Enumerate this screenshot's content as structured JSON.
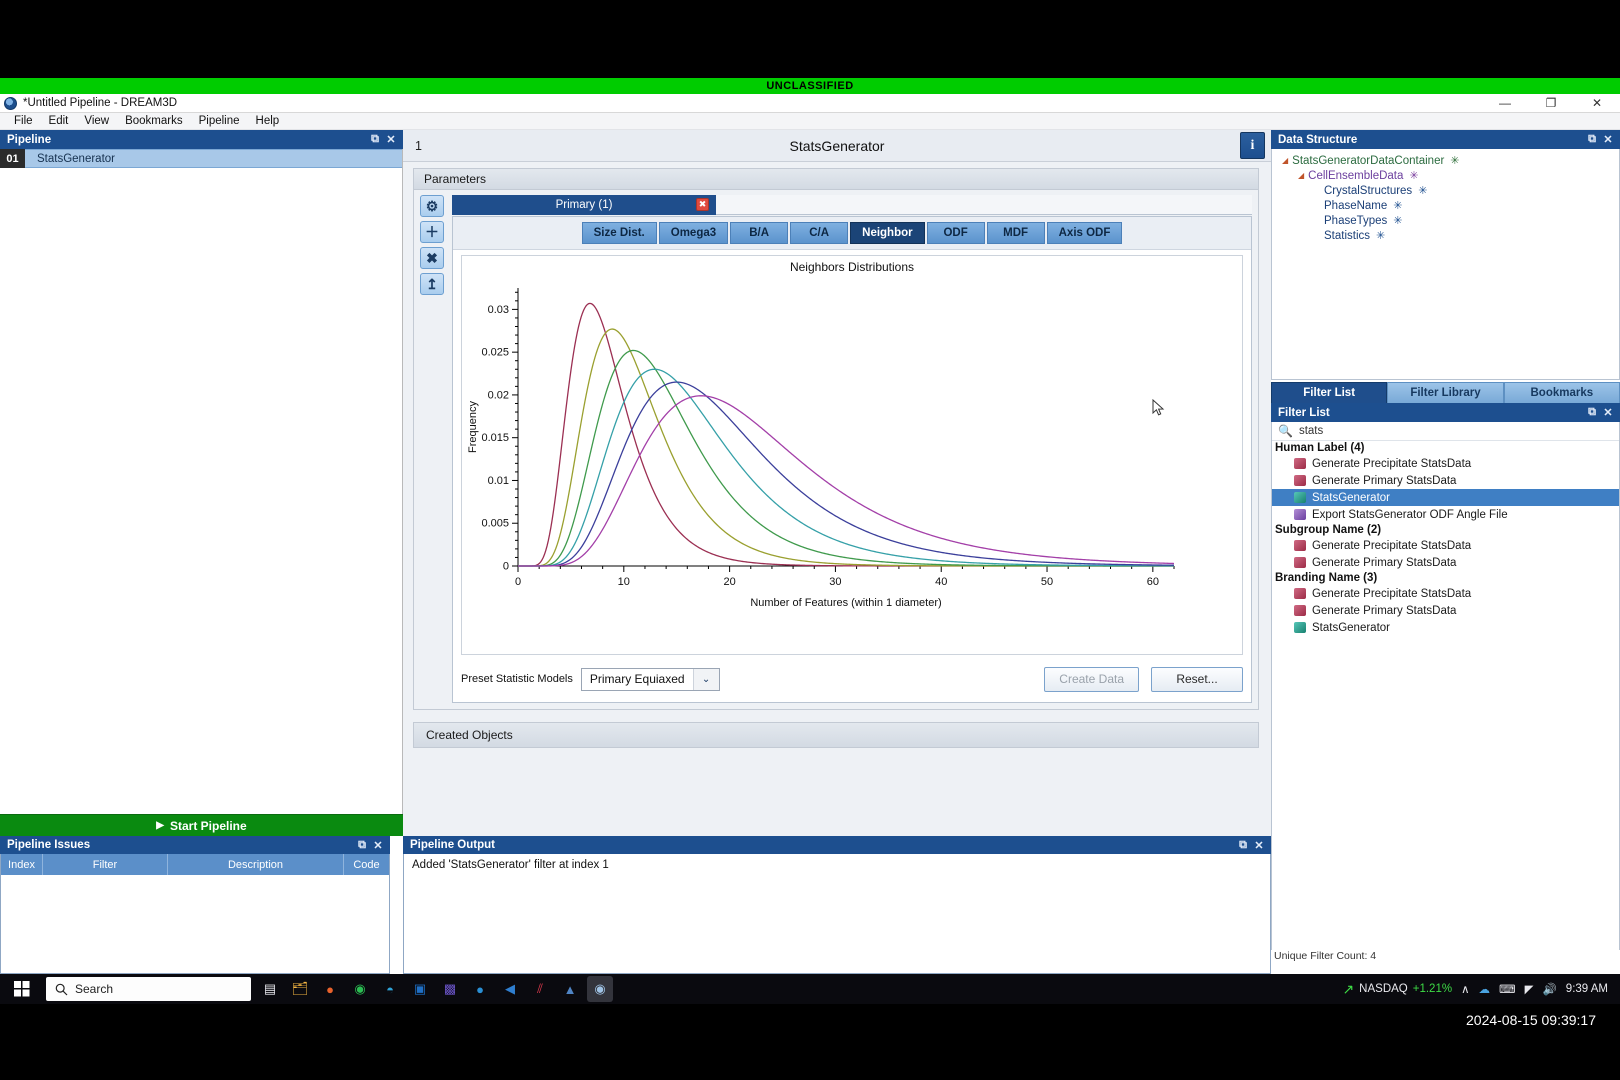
{
  "classification": {
    "banner": "UNCLASSIFIED",
    "color": "#00cc00"
  },
  "window": {
    "title": "*Untitled Pipeline - DREAM3D",
    "minimize": "—",
    "maximize": "❐",
    "close": "✕"
  },
  "menubar": {
    "items": [
      "File",
      "Edit",
      "View",
      "Bookmarks",
      "Pipeline",
      "Help"
    ]
  },
  "pipeline_dock": {
    "title": "Pipeline",
    "undock_glyph": "⧉",
    "close_glyph": "✕",
    "rows": [
      {
        "index": "01",
        "name": "StatsGenerator"
      }
    ],
    "start_button": "Start Pipeline",
    "start_glyph": "▶",
    "start_color": "#0a8a10"
  },
  "issues_dock": {
    "title": "Pipeline Issues",
    "undock_glyph": "⧉",
    "close_glyph": "✕",
    "columns": [
      "Index",
      "Filter",
      "Description",
      "Code"
    ],
    "rows": []
  },
  "statsgen": {
    "header_number": "1",
    "header_title": "StatsGenerator",
    "info_button": "i",
    "parameters_label": "Parameters",
    "vtools": [
      {
        "name": "gear-icon",
        "glyph": "⚙"
      },
      {
        "name": "plus-icon",
        "glyph": "＋"
      },
      {
        "name": "close-icon",
        "glyph": "✖"
      },
      {
        "name": "upload-icon",
        "glyph": "↥"
      }
    ],
    "phase_tab": {
      "label": "Primary (1)",
      "close_glyph": "✖"
    },
    "subtabs": [
      {
        "label": "Size Dist.",
        "active": false
      },
      {
        "label": "Omega3",
        "active": false
      },
      {
        "label": "B/A",
        "active": false
      },
      {
        "label": "C/A",
        "active": false
      },
      {
        "label": "Neighbor",
        "active": true
      },
      {
        "label": "ODF",
        "active": false
      },
      {
        "label": "MDF",
        "active": false
      },
      {
        "label": "Axis ODF",
        "active": false
      }
    ],
    "preset_label": "Preset Statistic Models",
    "preset_value": "Primary Equiaxed",
    "preset_arrow": "⌄",
    "create_data_button": "Create Data",
    "reset_button": "Reset...",
    "created_objects_label": "Created Objects"
  },
  "chart_data": {
    "type": "line",
    "title": "Neighbors Distributions",
    "xlabel": "Number of Features (within 1 diameter)",
    "ylabel": "Frequency",
    "xlim": [
      0,
      62
    ],
    "ylim": [
      0,
      0.0325
    ],
    "xticks": [
      0,
      10,
      20,
      30,
      40,
      50,
      60
    ],
    "yticks": [
      0,
      0.005,
      0.01,
      0.015,
      0.02,
      0.025,
      0.03
    ],
    "ytick_labels": [
      "0",
      "0.005",
      "0.01",
      "0.015",
      "0.02",
      "0.025",
      "0.03"
    ],
    "grid": false,
    "legend": "none",
    "series": [
      {
        "name": "Bin 1",
        "color": "#9b2f52",
        "peak_x": 6.8,
        "peak_y": 0.0307,
        "sigma_log": 0.4,
        "mu": 6.8
      },
      {
        "name": "Bin 2",
        "color": "#9aa02f",
        "peak_x": 8.9,
        "peak_y": 0.0277,
        "sigma_log": 0.4,
        "mu": 8.9
      },
      {
        "name": "Bin 3",
        "color": "#3f9a4c",
        "peak_x": 10.9,
        "peak_y": 0.0252,
        "sigma_log": 0.41,
        "mu": 10.9
      },
      {
        "name": "Bin 4",
        "color": "#35a0a8",
        "peak_x": 12.9,
        "peak_y": 0.023,
        "sigma_log": 0.42,
        "mu": 12.9
      },
      {
        "name": "Bin 5",
        "color": "#3b3f9b",
        "peak_x": 15.0,
        "peak_y": 0.0215,
        "sigma_log": 0.43,
        "mu": 15.0
      },
      {
        "name": "Bin 6",
        "color": "#a33fa8",
        "peak_x": 17.3,
        "peak_y": 0.0199,
        "sigma_log": 0.44,
        "mu": 17.3
      }
    ]
  },
  "data_structure": {
    "title": "Data Structure",
    "undock_glyph": "⧉",
    "close_glyph": "✕",
    "nodes": [
      {
        "label": "StatsGeneratorDataContainer",
        "depth": 0,
        "expander": "◢",
        "star": "✳",
        "star_class": ""
      },
      {
        "label": "CellEnsembleData",
        "depth": 1,
        "expander": "◢",
        "star": "✳",
        "star_class": "p"
      },
      {
        "label": "CrystalStructures",
        "depth": 2,
        "expander": "",
        "star": "✳",
        "star_class": "b"
      },
      {
        "label": "PhaseName",
        "depth": 2,
        "expander": "",
        "star": "✳",
        "star_class": "b"
      },
      {
        "label": "PhaseTypes",
        "depth": 2,
        "expander": "",
        "star": "✳",
        "star_class": "b"
      },
      {
        "label": "Statistics",
        "depth": 2,
        "expander": "",
        "star": "✳",
        "star_class": "b"
      }
    ]
  },
  "filter_tabs": [
    {
      "label": "Filter List",
      "active": true
    },
    {
      "label": "Filter Library",
      "active": false
    },
    {
      "label": "Bookmarks",
      "active": false
    }
  ],
  "filter_list": {
    "title": "Filter List",
    "undock_glyph": "⧉",
    "close_glyph": "✕",
    "search_icon": "🔍",
    "search_value": "stats",
    "search_placeholder": "",
    "groups": [
      {
        "label": "Human Label (4)",
        "items": [
          {
            "label": "Generate Precipitate StatsData",
            "cube": "red",
            "selected": false
          },
          {
            "label": "Generate Primary StatsData",
            "cube": "red",
            "selected": false
          },
          {
            "label": "StatsGenerator",
            "cube": "teal",
            "selected": true
          },
          {
            "label": "Export StatsGenerator ODF Angle File",
            "cube": "purple",
            "selected": false
          }
        ]
      },
      {
        "label": "Subgroup Name (2)",
        "items": [
          {
            "label": "Generate Precipitate StatsData",
            "cube": "red",
            "selected": false
          },
          {
            "label": "Generate Primary StatsData",
            "cube": "red",
            "selected": false
          }
        ]
      },
      {
        "label": "Branding Name (3)",
        "items": [
          {
            "label": "Generate Precipitate StatsData",
            "cube": "red",
            "selected": false
          },
          {
            "label": "Generate Primary StatsData",
            "cube": "red",
            "selected": false
          },
          {
            "label": "StatsGenerator",
            "cube": "teal",
            "selected": false
          }
        ]
      }
    ],
    "unique_count": "Unique Filter Count: 4"
  },
  "output_dock": {
    "title": "Pipeline Output",
    "undock_glyph": "⧉",
    "close_glyph": "✕",
    "lines": [
      "Added 'StatsGenerator' filter at index 1"
    ]
  },
  "taskbar": {
    "start_glyph": "⊞",
    "search_icon": "🔍",
    "search_label": "Search",
    "icons": [
      {
        "name": "task-view-icon",
        "glyph": "◱",
        "color": "#e8e8ee",
        "active": false
      },
      {
        "name": "file-explorer-icon",
        "glyph": "📁",
        "color": "#f2b441",
        "active": false
      },
      {
        "name": "firefox-icon",
        "glyph": "●",
        "color": "#e8622c",
        "active": false
      },
      {
        "name": "chrome-icon",
        "glyph": "◉",
        "color": "#2bbd52",
        "active": false
      },
      {
        "name": "edge-icon",
        "glyph": "◔",
        "color": "#2fa3d8",
        "active": false
      },
      {
        "name": "outlook-icon",
        "glyph": "▣",
        "color": "#1f6fc4",
        "active": false
      },
      {
        "name": "teams-icon",
        "glyph": "⬟",
        "color": "#6b55c9",
        "active": false
      },
      {
        "name": "skype-icon",
        "glyph": "●",
        "color": "#2a8fd4",
        "active": false
      },
      {
        "name": "vscode-icon",
        "glyph": "◀",
        "color": "#2f7fd0",
        "active": false
      },
      {
        "name": "jetbrains-icon",
        "glyph": "⫽",
        "color": "#e23b4e",
        "active": false
      },
      {
        "name": "paraview-icon",
        "glyph": "▲",
        "color": "#4f84c4",
        "active": false
      },
      {
        "name": "dream3d-icon",
        "glyph": "◉",
        "color": "#7fa8d6",
        "active": true
      }
    ],
    "tray": {
      "stock_arrow": "↗",
      "stock_name": "NASDAQ",
      "stock_change": "+1.21%",
      "chevron": "∧",
      "onedrive": "☁",
      "network_tray": "⌨",
      "wifi": "◤",
      "volume": "🔊",
      "clock": "9:39 AM"
    }
  },
  "overlay": {
    "timestamp": "2024-08-15 09:39:17"
  }
}
